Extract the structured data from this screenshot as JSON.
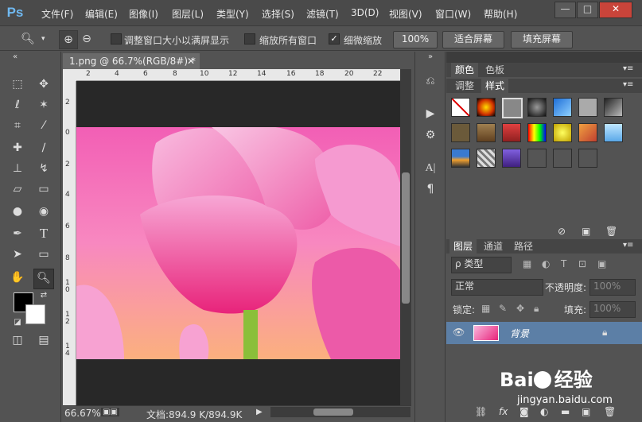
{
  "app": {
    "logo": "Ps",
    "menu": [
      "文件(F)",
      "编辑(E)",
      "图像(I)",
      "图层(L)",
      "类型(Y)",
      "选择(S)",
      "滤镜(T)",
      "3D(D)",
      "视图(V)",
      "窗口(W)",
      "帮助(H)"
    ],
    "window_buttons": {
      "minimize": "—",
      "restore": "□",
      "close": "✕"
    }
  },
  "options_bar": {
    "resize_windows_label": "调整窗口大小以满屏显示",
    "zoom_all_label": "缩放所有窗口",
    "scrubby_zoom_label": "细微缩放",
    "zoom_100_label": "100%",
    "fit_screen_label": "适合屏幕",
    "fill_screen_label": "填充屏幕",
    "resize_windows_checked": false,
    "zoom_all_checked": false,
    "scrubby_zoom_checked": true
  },
  "document": {
    "tab_title": "1.png @ 66.7%(RGB/8#) *",
    "ruler_top_ticks": [
      "2",
      "4",
      "6",
      "8",
      "10",
      "12",
      "14",
      "16",
      "18",
      "20",
      "22"
    ],
    "ruler_left_ticks": [
      "2",
      "0",
      "2",
      "4",
      "6",
      "8",
      "1\n0",
      "1\n2",
      "1\n4"
    ]
  },
  "status": {
    "zoom": "66.67%",
    "doc_info": "文档:894.9 K/894.9K"
  },
  "styles_panel": {
    "tabs_row1": [
      "颜色",
      "色板"
    ],
    "tabs_row2": [
      "调整",
      "样式"
    ]
  },
  "layers_panel": {
    "tabs": [
      "图层",
      "通道",
      "路径"
    ],
    "kind_label": "ρ 类型",
    "blend_mode": "正常",
    "opacity_label": "不透明度:",
    "opacity_value": "100%",
    "lock_label": "锁定:",
    "fill_label": "填充:",
    "fill_value": "100%",
    "layer_name": "背景"
  },
  "watermark": {
    "brand": "Bai",
    "brand_cn": "经验",
    "url": "jingyan.baidu.com"
  },
  "colors": {
    "accent_blue": "#6fb8f0",
    "layer_selected": "#5c7fa6",
    "close_red": "#c9443a"
  }
}
